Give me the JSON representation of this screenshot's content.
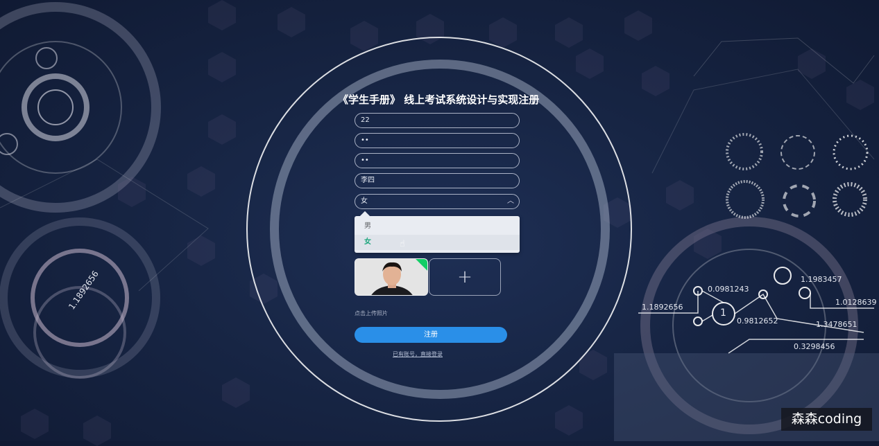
{
  "form": {
    "title": "《学生手册》 线上考试系统设计与实现注册",
    "fields": [
      {
        "value": "22"
      },
      {
        "value": "••"
      },
      {
        "value": "••"
      },
      {
        "value": "李四"
      }
    ],
    "gender": {
      "selected": "女",
      "options": [
        "男",
        "女"
      ]
    },
    "upload": {
      "plus": "+",
      "hint": "点击上传照片"
    },
    "register_label": "注册",
    "login_link": "已有账号，直接登录"
  },
  "decor": {
    "numbers": [
      "1.1892656",
      "0.0981243",
      "1.1983457",
      "1.0128639",
      "1.1892656",
      "1",
      "0.9812652",
      "1.3478651",
      "0.3298456"
    ]
  },
  "watermark": "森森coding",
  "colors": {
    "accent": "#2a8fe8",
    "selected_option": "#1ba57c",
    "background": "#172544"
  }
}
